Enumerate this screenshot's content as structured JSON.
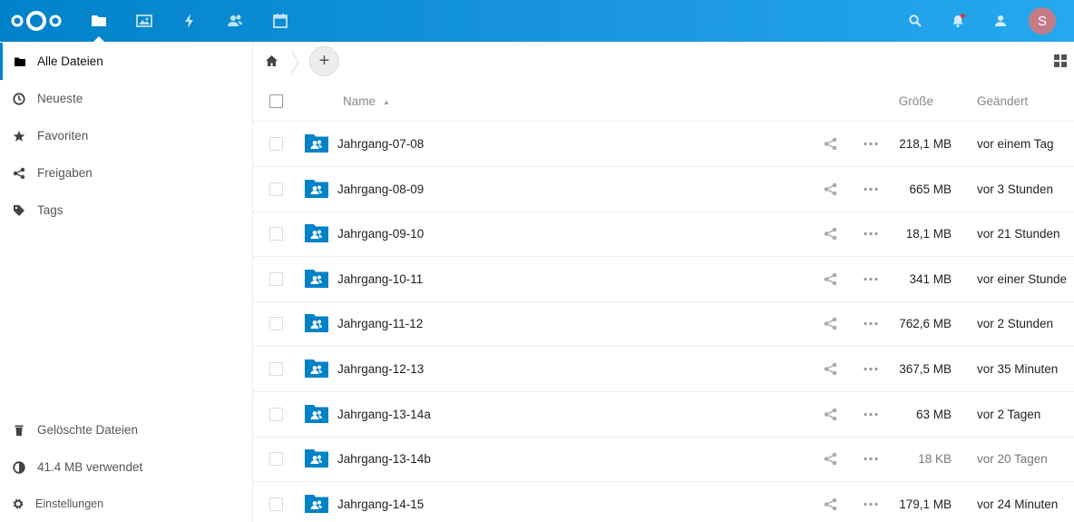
{
  "header": {
    "apps": [
      {
        "name": "files",
        "icon": "folder-icon"
      },
      {
        "name": "photos",
        "icon": "image-icon"
      },
      {
        "name": "activity",
        "icon": "lightning-icon"
      },
      {
        "name": "contacts",
        "icon": "contacts-icon"
      },
      {
        "name": "calendar",
        "icon": "calendar-icon"
      }
    ],
    "avatar_letter": "S",
    "avatar_color": "#c37b87",
    "brand_color": "#0082c9"
  },
  "sidebar": {
    "items": [
      {
        "label": "Alle Dateien",
        "icon": "folder-icon"
      },
      {
        "label": "Neueste",
        "icon": "clock-icon"
      },
      {
        "label": "Favoriten",
        "icon": "star-icon"
      },
      {
        "label": "Freigaben",
        "icon": "share-icon"
      },
      {
        "label": "Tags",
        "icon": "tag-icon"
      }
    ],
    "bottom": {
      "deleted": "Gelöschte Dateien",
      "quota": "41.4 MB verwendet",
      "settings": "Einstellungen"
    }
  },
  "table": {
    "headers": {
      "name": "Name",
      "size": "Größe",
      "modified": "Geändert"
    },
    "rows": [
      {
        "name": "Jahrgang-07-08",
        "size": "218,1 MB",
        "modified": "vor einem Tag"
      },
      {
        "name": "Jahrgang-08-09",
        "size": "665 MB",
        "modified": "vor 3 Stunden"
      },
      {
        "name": "Jahrgang-09-10",
        "size": "18,1 MB",
        "modified": "vor 21 Stunden"
      },
      {
        "name": "Jahrgang-10-11",
        "size": "341 MB",
        "modified": "vor einer Stunde"
      },
      {
        "name": "Jahrgang-11-12",
        "size": "762,6 MB",
        "modified": "vor 2 Stunden"
      },
      {
        "name": "Jahrgang-12-13",
        "size": "367,5 MB",
        "modified": "vor 35 Minuten"
      },
      {
        "name": "Jahrgang-13-14a",
        "size": "63 MB",
        "modified": "vor 2 Tagen"
      },
      {
        "name": "Jahrgang-13-14b",
        "size": "18 KB",
        "modified": "vor 20 Tagen"
      },
      {
        "name": "Jahrgang-14-15",
        "size": "179,1 MB",
        "modified": "vor 24 Minuten"
      }
    ]
  }
}
